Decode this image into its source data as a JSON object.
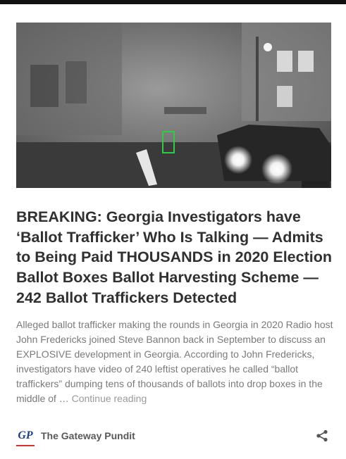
{
  "article": {
    "headline": "BREAKING: Georgia Investigators have ‘Ballot Trafficker’ Who Is Talking — Admits to Being Paid THOUSANDS in 2020 Election Ballot Boxes Ballot Harvesting Scheme — 242 Ballot Traffickers Detected",
    "excerpt": "Alleged ballot trafficker making the rounds in Georgia in 2020 Radio host John Fredericks joined Steve Bannon back in September to discuss an EXPLOSIVE development in Georgia. According to John Fredericks, investigators have video of 240 leftist operatives he called “ballot traffickers” dumping tens of thousands of ballots into drop boxes in the middle of …",
    "continue_label": "Continue reading"
  },
  "source": {
    "logo_text": "GP",
    "name": "The Gateway Pundit"
  },
  "icons": {
    "share": "share-icon"
  },
  "colors": {
    "logo_blue": "#1c3e8a",
    "logo_red": "#d0342c",
    "detection_box": "#2ecc40"
  }
}
